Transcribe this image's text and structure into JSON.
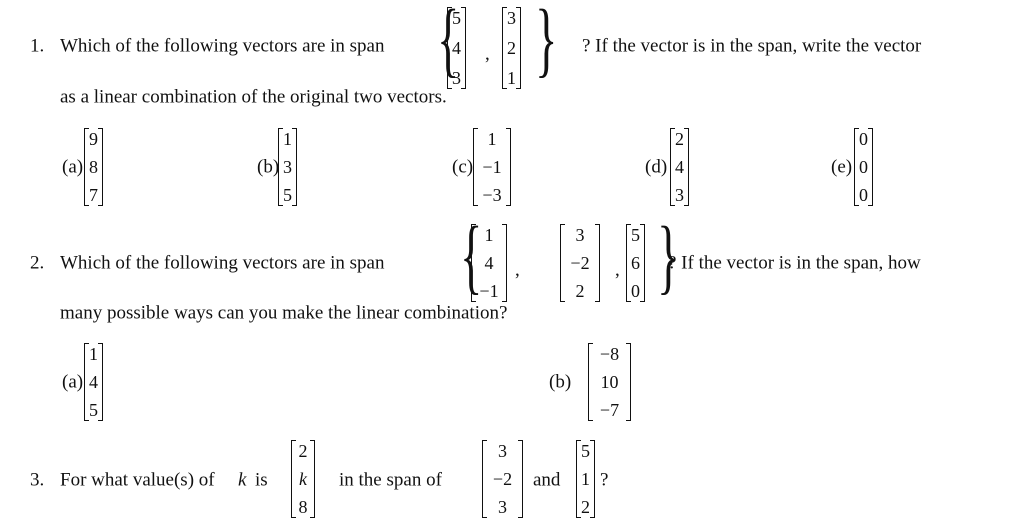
{
  "q1": {
    "number": "1.",
    "text_before": "Which of the following vectors are in span",
    "text_after": "? If the vector is in the span, write the vector",
    "line2": "as a linear combination of the original two vectors.",
    "span_vectors": [
      [
        "5",
        "4",
        "3"
      ],
      [
        "3",
        "2",
        "1"
      ]
    ],
    "comma": ",",
    "options": [
      {
        "label": "(a)",
        "vector": [
          "9",
          "8",
          "7"
        ]
      },
      {
        "label": "(b)",
        "vector": [
          "1",
          "3",
          "5"
        ]
      },
      {
        "label": "(c)",
        "vector": [
          "1",
          "−1",
          "−3"
        ]
      },
      {
        "label": "(d)",
        "vector": [
          "2",
          "4",
          "3"
        ]
      },
      {
        "label": "(e)",
        "vector": [
          "0",
          "0",
          "0"
        ]
      }
    ]
  },
  "q2": {
    "number": "2.",
    "text_before": "Which of the following vectors are in span",
    "text_after": "? If the vector is in the span, how",
    "line2": "many possible ways can you make the linear combination?",
    "span_vectors": [
      [
        "1",
        "4",
        "−1"
      ],
      [
        "3",
        "−2",
        "2"
      ],
      [
        "5",
        "6",
        "0"
      ]
    ],
    "comma": ",",
    "options": [
      {
        "label": "(a)",
        "vector": [
          "1",
          "4",
          "5"
        ]
      },
      {
        "label": "(b)",
        "vector": [
          "−8",
          "10",
          "−7"
        ]
      }
    ]
  },
  "q3": {
    "number": "3.",
    "text_before": "For what value(s) of",
    "variable": "k",
    "text_is": "is",
    "vector": [
      "2",
      "k",
      "8"
    ],
    "text_span": "in the span of",
    "span_vectors": [
      [
        "3",
        "−2",
        "3"
      ],
      [
        "5",
        "1",
        "2"
      ]
    ],
    "text_and": "and",
    "text_end": "?"
  }
}
